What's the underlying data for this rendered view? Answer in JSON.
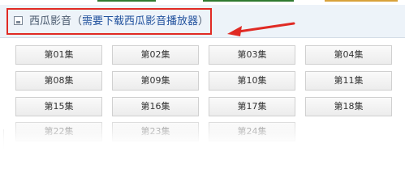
{
  "source": {
    "name": "西瓜影音",
    "paren_open": "（",
    "note": "需要下载西瓜影音播放器",
    "paren_close": "）",
    "icon": "square-frame-icon"
  },
  "annotation": {
    "arrow_color": "#e02a24",
    "box_color": "#e02a24"
  },
  "episodes": {
    "rows": [
      [
        "第01集",
        "第02集",
        "第03集",
        "第04集"
      ],
      [
        "第08集",
        "第09集",
        "第10集",
        "第11集"
      ],
      [
        "第15集",
        "第16集",
        "第17集",
        "第18集"
      ],
      [
        "第22集",
        "第23集",
        "第24集"
      ]
    ]
  }
}
